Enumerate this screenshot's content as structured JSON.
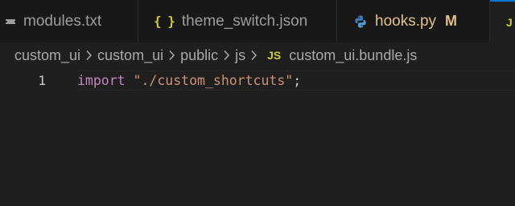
{
  "tabs": [
    {
      "label": "modules.txt",
      "icon": "text-file-icon"
    },
    {
      "label": "theme_switch.json",
      "icon": "json-braces-icon",
      "icon_glyph": "{ }"
    },
    {
      "label": "hooks.py",
      "icon": "python-icon",
      "modified_badge": "M"
    },
    {
      "label": "",
      "icon": "js-file-icon",
      "icon_glyph": "J",
      "active": true
    }
  ],
  "breadcrumb": {
    "items": [
      "custom_ui",
      "custom_ui",
      "public",
      "js"
    ],
    "file_icon": "JS",
    "file": "custom_ui.bundle.js"
  },
  "editor": {
    "lines": [
      {
        "number": "1",
        "keyword": "import",
        "space": " ",
        "string": "\"./custom_shortcuts\"",
        "terminator": ";"
      }
    ]
  },
  "colors": {
    "keyword": "#c586c0",
    "string": "#ce9178",
    "modified": "#e2c08d",
    "js_icon": "#cbcb41",
    "python_blue": "#3e7cb5",
    "active_tab_border": "#0078d4"
  }
}
